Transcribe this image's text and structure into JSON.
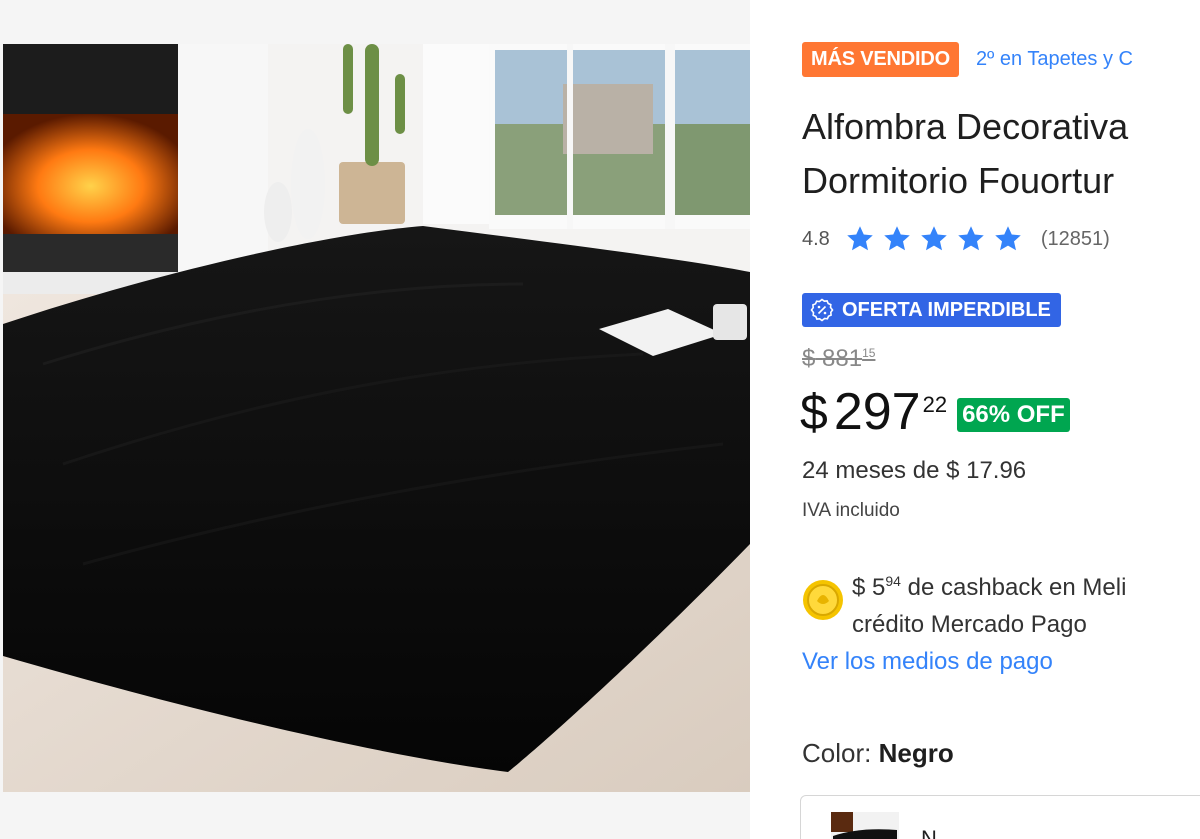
{
  "product_image": {
    "alt": "Alfombra negra en sala con chimenea"
  },
  "badges": {
    "bestseller": "MÁS VENDIDO",
    "rank": "2º en Tapetes y C"
  },
  "title": {
    "line1": "Alfombra Decorativa",
    "line2": "Dormitorio Fouortur"
  },
  "rating": {
    "value": "4.8",
    "stars": 5,
    "reviews": "(12851)",
    "star_color": "#3483fa"
  },
  "deal": {
    "label": "OFERTA IMPERDIBLE",
    "color": "#3265e5"
  },
  "price": {
    "old_symbol": "$",
    "old_amount": "881",
    "old_cents": "15",
    "symbol": "$",
    "amount": "297",
    "cents": "22",
    "discount": "66% OFF",
    "discount_color": "#00a650"
  },
  "installments": "24 meses de $ 17.96",
  "iva": "IVA incluido",
  "cashback": {
    "prefix": "$ 5",
    "cents": "94",
    "line1_rest": " de cashback en Meli",
    "line2": "crédito Mercado Pago"
  },
  "payment_link": "Ver los medios de pago",
  "color": {
    "label": "Color:",
    "value": "Negro",
    "swatch_label": "N"
  },
  "icons": {
    "deal": "discount-badge-icon",
    "cashback": "coin-icon",
    "star": "star-icon"
  }
}
